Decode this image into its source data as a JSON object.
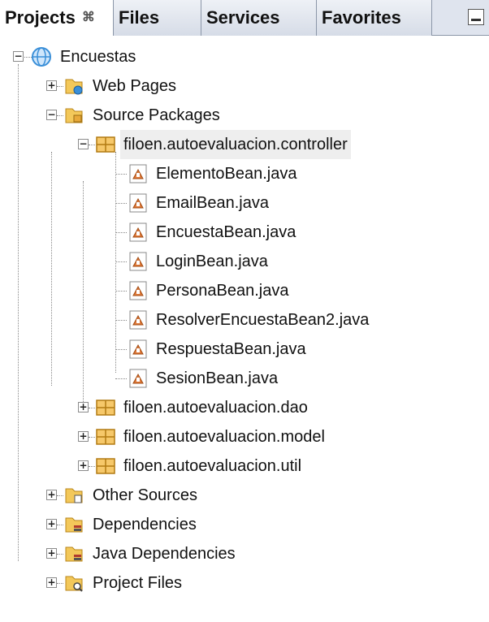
{
  "tabs": [
    {
      "label": "Projects",
      "active": true,
      "close": "⌘"
    },
    {
      "label": "Files"
    },
    {
      "label": "Services"
    },
    {
      "label": "Favorites"
    }
  ],
  "tree": {
    "root": "Encuestas",
    "web_pages": "Web Pages",
    "source_packages": "Source Packages",
    "pkg_controller": "filoen.autoevaluacion.controller",
    "files": [
      "ElementoBean.java",
      "EmailBean.java",
      "EncuestaBean.java",
      "LoginBean.java",
      "PersonaBean.java",
      "ResolverEncuestaBean2.java",
      "RespuestaBean.java",
      "SesionBean.java"
    ],
    "pkg_dao": "filoen.autoevaluacion.dao",
    "pkg_model": "filoen.autoevaluacion.model",
    "pkg_util": "filoen.autoevaluacion.util",
    "other_sources": "Other Sources",
    "dependencies": "Dependencies",
    "java_dependencies": "Java Dependencies",
    "project_files": "Project Files"
  },
  "colors": {
    "folder": "#e8b84a",
    "package": "#e8a93a",
    "java_file": "#e07a3a",
    "globe": "#3a8fd8"
  }
}
